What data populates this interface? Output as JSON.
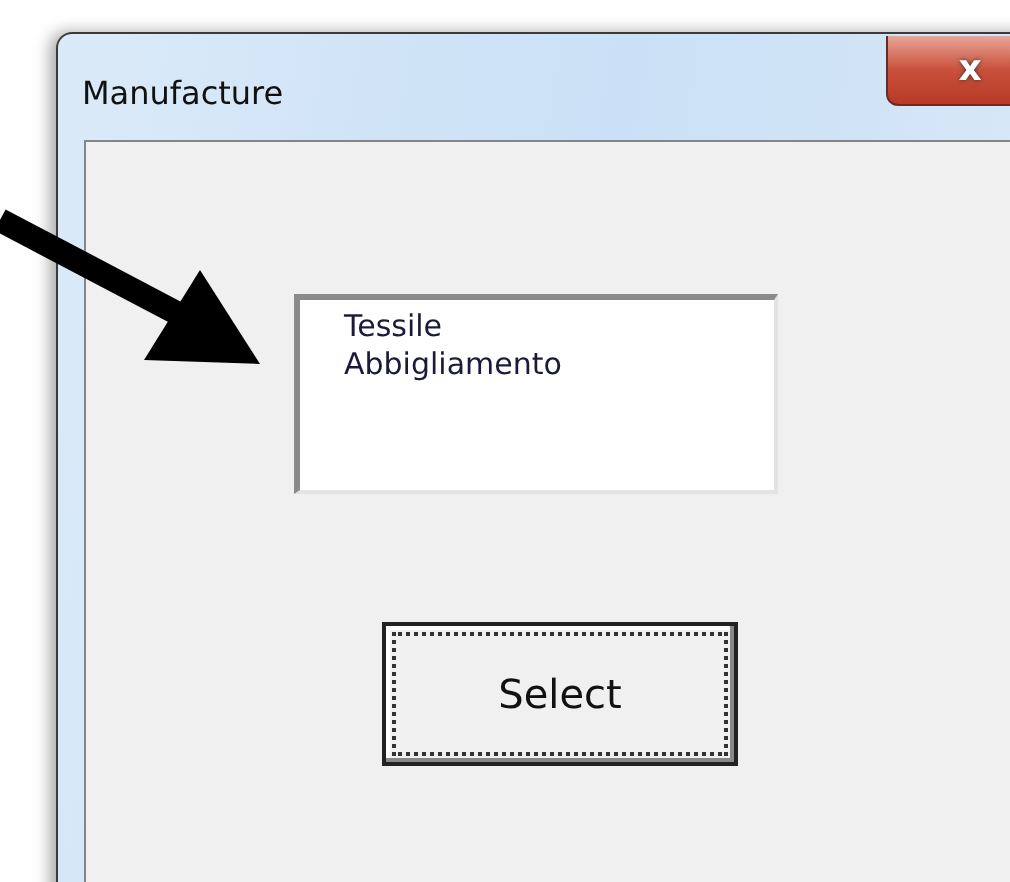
{
  "window": {
    "title": "Manufacture",
    "close_glyph": "x"
  },
  "listbox": {
    "items": [
      {
        "label": "Tessile",
        "selected": false
      },
      {
        "label": "Abbigliamento",
        "selected": false
      }
    ]
  },
  "buttons": [
    {
      "label": "Select",
      "focused": true
    }
  ]
}
